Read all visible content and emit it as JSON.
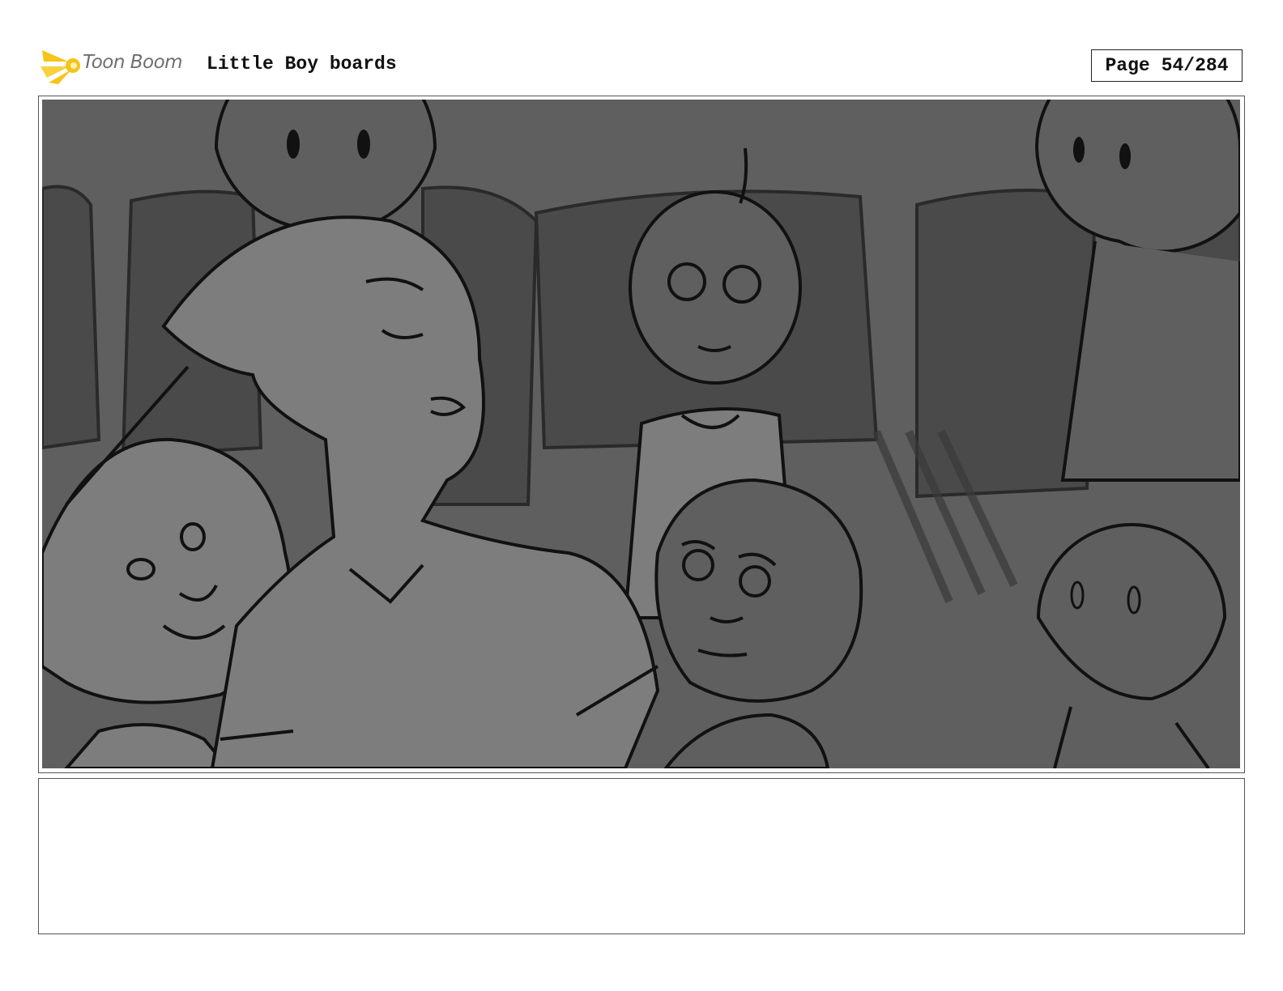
{
  "header": {
    "brand": "Toon Boom",
    "title": "Little Boy boards",
    "page_label": "Page",
    "page_number": "54/284"
  },
  "panel": {
    "description_visible": false
  },
  "caption": {
    "text": ""
  },
  "colors": {
    "logo_yellow": "#f5c518",
    "sketch_dark": "#4a4a4a",
    "sketch_mid": "#5f5f5f",
    "sketch_light": "#7d7d7d",
    "ink": "#111111"
  }
}
